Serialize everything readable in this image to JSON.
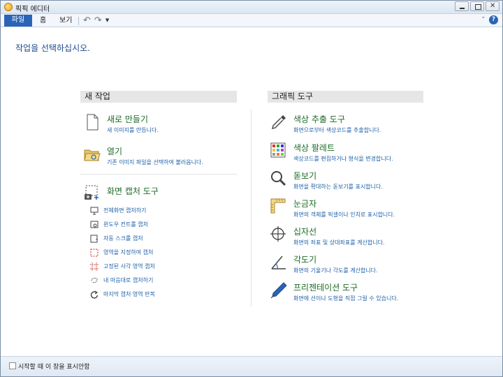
{
  "window": {
    "title": "픽픽 에디터"
  },
  "tabs": {
    "file": "파일",
    "home": "홈",
    "view": "보기"
  },
  "content": {
    "instruction": "작업을 선택하십시오.",
    "new_task": {
      "header": "새 작업",
      "new_doc": {
        "title": "새로 만들기",
        "desc": "새 이미지를 만듭니다."
      },
      "open": {
        "title": "열기",
        "desc": "기존 이미지 파일을 선택하여 불러옵니다."
      },
      "capture": {
        "title": "화면 캡처 도구",
        "items": [
          {
            "label": "전체화면 캡처하기",
            "icon": "monitor-icon"
          },
          {
            "label": "윈도우 컨트롤 캡처",
            "icon": "window-control-icon"
          },
          {
            "label": "자동 스크롤 캡처",
            "icon": "scroll-icon"
          },
          {
            "label": "영역을 지정하여 캡처",
            "icon": "region-icon"
          },
          {
            "label": "고정된 사각 영역 캡처",
            "icon": "fixed-region-icon"
          },
          {
            "label": "내 마음대로 캡처하기",
            "icon": "freehand-icon"
          },
          {
            "label": "마지막 캡처 영역 반복",
            "icon": "repeat-icon"
          }
        ]
      }
    },
    "graphic_tools": {
      "header": "그래픽 도구",
      "items": [
        {
          "title": "색상 추출 도구",
          "desc": "화면으로부터 색상코드를 추출합니다.",
          "icon": "eyedropper-icon"
        },
        {
          "title": "색상 팔레트",
          "desc": "색상코드를 편집하거나 형식을 변경합니다.",
          "icon": "palette-icon"
        },
        {
          "title": "돋보기",
          "desc": "화면을 확대하는 돋보기를 표시합니다.",
          "icon": "magnifier-icon"
        },
        {
          "title": "눈금자",
          "desc": "화면의 객체를 픽셀이나 인치로 표시합니다.",
          "icon": "ruler-icon"
        },
        {
          "title": "십자선",
          "desc": "화면의 좌표 및 상대좌표를 계산합니다.",
          "icon": "crosshair-icon"
        },
        {
          "title": "각도기",
          "desc": "화면의 기울기나 각도를 계산합니다.",
          "icon": "protractor-icon"
        },
        {
          "title": "프리젠테이션 도구",
          "desc": "화면에 선이나 도형을 직접 그릴 수 있습니다.",
          "icon": "pen-icon"
        }
      ]
    }
  },
  "statusbar": {
    "checkbox_label": "시작할 때 이 창을 표시안함",
    "checked": false
  }
}
